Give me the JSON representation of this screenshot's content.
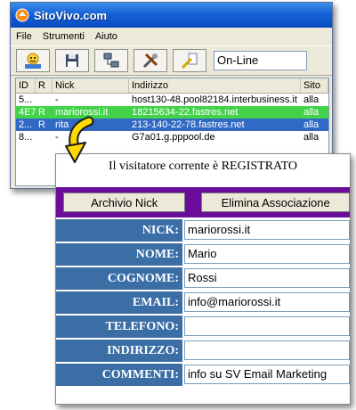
{
  "window": {
    "title": "SitoVivo.com",
    "menu": [
      "File",
      "Strumenti",
      "Aiuto"
    ],
    "toolbar_icons": [
      "user-icon",
      "save-icon",
      "network-icon",
      "tools-icon",
      "edit-icon"
    ],
    "status_value": "On-Line"
  },
  "visitor_list": {
    "columns": [
      "ID",
      "R",
      "Nick",
      "Indirizzo",
      "Sito"
    ],
    "rows": [
      [
        "5...",
        "",
        "-",
        "host130-48.pool82184.interbusiness.it",
        "alla"
      ],
      [
        "4E7",
        "R",
        "mariorossi.it",
        "18215634-22.fastres.net",
        "alla"
      ],
      [
        "2...",
        "R",
        "rita",
        "213-140-22-78.fastres.net",
        "alla"
      ],
      [
        "8...",
        "",
        "-",
        "G7a01.g.pppool.de",
        "alla"
      ]
    ]
  },
  "panel": {
    "header": "Il visitatore corrente è REGISTRATO",
    "buttons": {
      "archive": "Archivio Nick",
      "delete": "Elimina Associazione"
    },
    "fields": [
      {
        "label": "NICK:",
        "value": "mariorossi.it"
      },
      {
        "label": "NOME:",
        "value": "Mario"
      },
      {
        "label": "COGNOME:",
        "value": "Rossi"
      },
      {
        "label": "EMAIL:",
        "value": "info@mariorossi.it"
      },
      {
        "label": "TELEFONO:",
        "value": ""
      },
      {
        "label": "INDIRIZZO:",
        "value": ""
      },
      {
        "label": "COMMENTI:",
        "value": "info su SV Email Marketing"
      }
    ]
  },
  "colors": {
    "titlebar": "#0a4ac0",
    "selected_green": "#44d24a",
    "selected_blue": "#316ac5",
    "purple_bar": "#6a0d9a",
    "label_blue": "#3a6ea5"
  }
}
